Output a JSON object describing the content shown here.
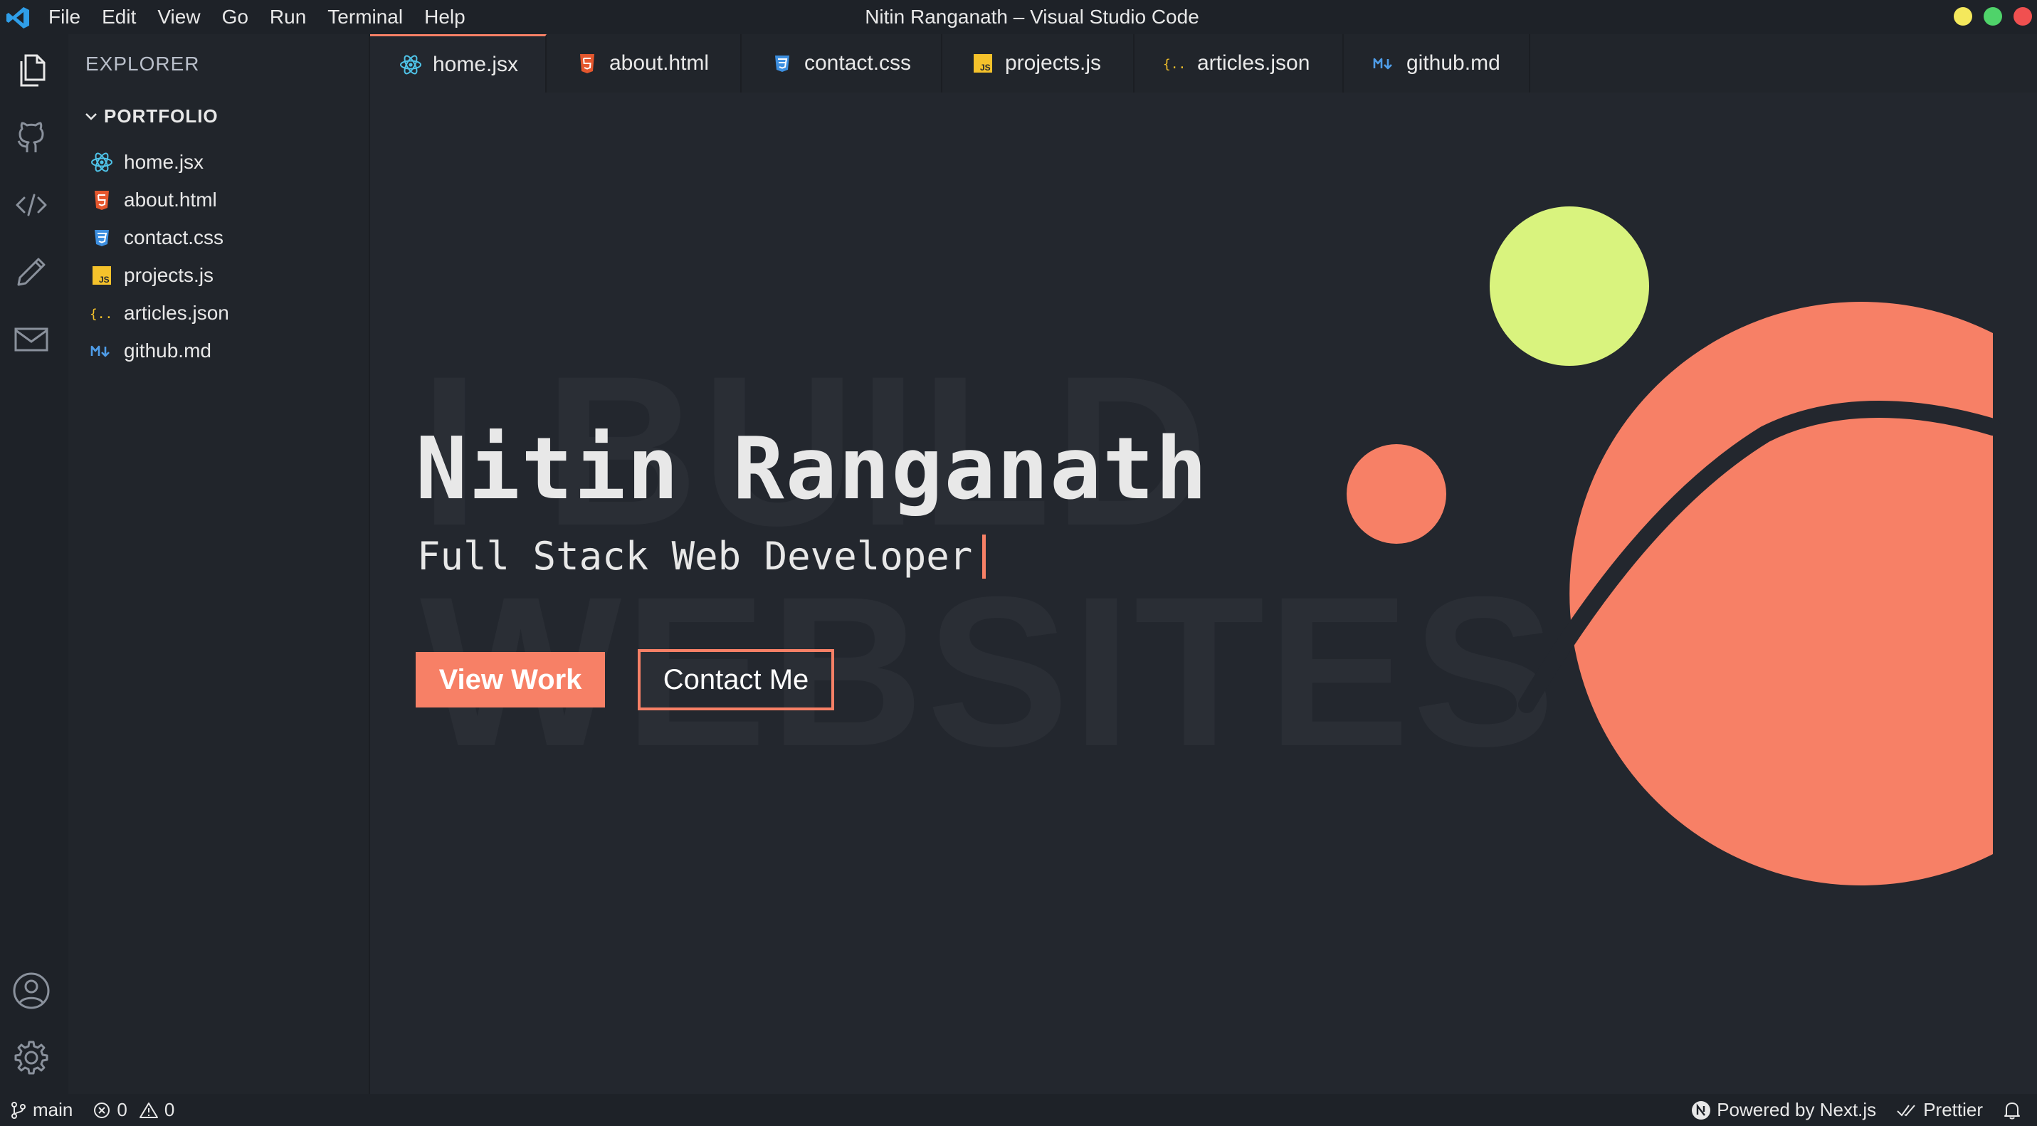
{
  "window": {
    "title": "Nitin Ranganath – Visual Studio Code"
  },
  "menu": [
    "File",
    "Edit",
    "View",
    "Go",
    "Run",
    "Terminal",
    "Help"
  ],
  "traffic_lights": [
    "#f4e85c",
    "#4fd36a",
    "#f05050"
  ],
  "activity_bar": {
    "top": [
      "files-icon",
      "github-icon",
      "code-icon",
      "pencil-icon",
      "mail-icon"
    ],
    "bottom": [
      "account-icon",
      "settings-gear-icon"
    ]
  },
  "sidebar": {
    "title": "EXPLORER",
    "folder": "PORTFOLIO",
    "files": [
      {
        "name": "home.jsx",
        "icon": "react-icon"
      },
      {
        "name": "about.html",
        "icon": "html5-icon"
      },
      {
        "name": "contact.css",
        "icon": "css3-icon"
      },
      {
        "name": "projects.js",
        "icon": "javascript-icon"
      },
      {
        "name": "articles.json",
        "icon": "json-icon"
      },
      {
        "name": "github.md",
        "icon": "markdown-icon"
      }
    ]
  },
  "tabs": [
    {
      "label": "home.jsx",
      "active": true
    },
    {
      "label": "about.html",
      "active": false
    },
    {
      "label": "contact.css",
      "active": false
    },
    {
      "label": "projects.js",
      "active": false
    },
    {
      "label": "articles.json",
      "active": false
    },
    {
      "label": "github.md",
      "active": false
    }
  ],
  "hero": {
    "background_line1": "I BUILD",
    "background_line2": "WEBSITES",
    "name": "Nitin Ranganath",
    "role": "Full Stack Web Developer",
    "primary_button": "View Work",
    "secondary_button": "Contact Me"
  },
  "colors": {
    "accent": "#f78066",
    "lime": "#d9f37e",
    "editor_bg": "#23272e",
    "sidebar_bg": "#21252b"
  },
  "status_bar": {
    "branch": "main",
    "errors": "0",
    "warnings": "0",
    "powered_by": "Powered by Next.js",
    "formatter": "Prettier"
  }
}
